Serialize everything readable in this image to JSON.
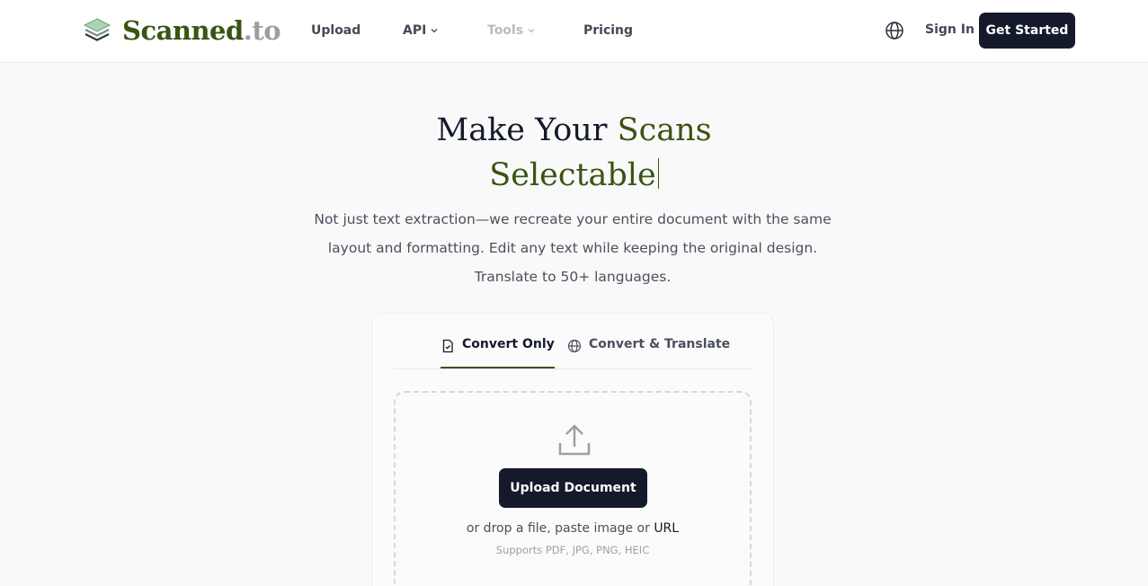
{
  "header": {
    "logo": {
      "main": "Scanned",
      "suffix": ".to",
      "icon": "layers-logo-icon"
    },
    "nav": [
      {
        "label": "Upload"
      },
      {
        "label": "API",
        "icon": "chevron-down-icon"
      },
      {
        "label": "Tools",
        "icon": "chevron-down-icon",
        "state": "disabled"
      },
      {
        "label": "Pricing"
      }
    ],
    "language_icon": "globe-icon",
    "sign_in": "Sign In",
    "get_started": "Get Started"
  },
  "hero": {
    "title_part1": "Make Your ",
    "title_part2": "Scans",
    "title_line2": "Selectable",
    "subtitle": "Not just text extraction—we recreate your entire document with the same layout and formatting. Edit any text while keeping the original design. Translate to 50+ languages."
  },
  "uploader": {
    "tabs": [
      {
        "label": "Convert Only",
        "icon": "document-check-icon",
        "active": true
      },
      {
        "label": "Convert & Translate",
        "icon": "globe-icon",
        "active": false
      }
    ],
    "upload_icon": "upload-icon",
    "upload_button": "Upload Document",
    "drop_text": "or drop a file, paste image or ",
    "drop_link": "URL",
    "supports": "Supports PDF, JPG, PNG, HEIC"
  },
  "colors": {
    "brand": "#3b5313",
    "dark": "#141a2b",
    "muted": "#9aa0a6",
    "background": "#f9f9f9"
  }
}
